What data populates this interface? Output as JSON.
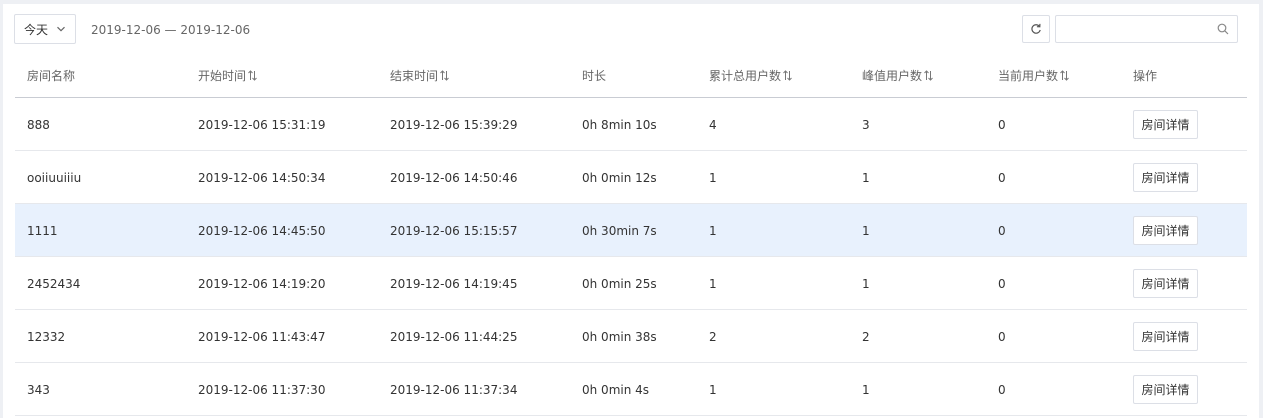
{
  "toolbar": {
    "range_label": "今天",
    "date_range": "2019-12-06 — 2019-12-06",
    "search_placeholder": "",
    "icons": {
      "range": "chevron-down-icon",
      "refresh": "refresh-icon",
      "search": "search-icon",
      "sort": "sort-icon"
    }
  },
  "table": {
    "columns": [
      "房间名称",
      "开始时间",
      "结束时间",
      "时长",
      "累计总用户数",
      "峰值用户数",
      "当前用户数",
      "操作"
    ],
    "rows": [
      {
        "name": "888",
        "start": "2019-12-06 15:31:19",
        "end": "2019-12-06 15:39:29",
        "duration": "0h 8min 10s",
        "total": "4",
        "peak": "3",
        "current": "0",
        "action": "房间详情"
      },
      {
        "name": "ooiiuuiiiu",
        "start": "2019-12-06 14:50:34",
        "end": "2019-12-06 14:50:46",
        "duration": "0h 0min 12s",
        "total": "1",
        "peak": "1",
        "current": "0",
        "action": "房间详情"
      },
      {
        "name": "1111",
        "start": "2019-12-06 14:45:50",
        "end": "2019-12-06 15:15:57",
        "duration": "0h 30min 7s",
        "total": "1",
        "peak": "1",
        "current": "0",
        "action": "房间详情"
      },
      {
        "name": "2452434",
        "start": "2019-12-06 14:19:20",
        "end": "2019-12-06 14:19:45",
        "duration": "0h 0min 25s",
        "total": "1",
        "peak": "1",
        "current": "0",
        "action": "房间详情"
      },
      {
        "name": "12332",
        "start": "2019-12-06 11:43:47",
        "end": "2019-12-06 11:44:25",
        "duration": "0h 0min 38s",
        "total": "2",
        "peak": "2",
        "current": "0",
        "action": "房间详情"
      },
      {
        "name": "343",
        "start": "2019-12-06 11:37:30",
        "end": "2019-12-06 11:37:34",
        "duration": "0h 0min 4s",
        "total": "1",
        "peak": "1",
        "current": "0",
        "action": "房间详情"
      }
    ],
    "highlighted_row": 2
  },
  "colors": {
    "highlight_row": "#e8f1fd",
    "border": "#dcdfe6",
    "header_text": "#666666"
  }
}
